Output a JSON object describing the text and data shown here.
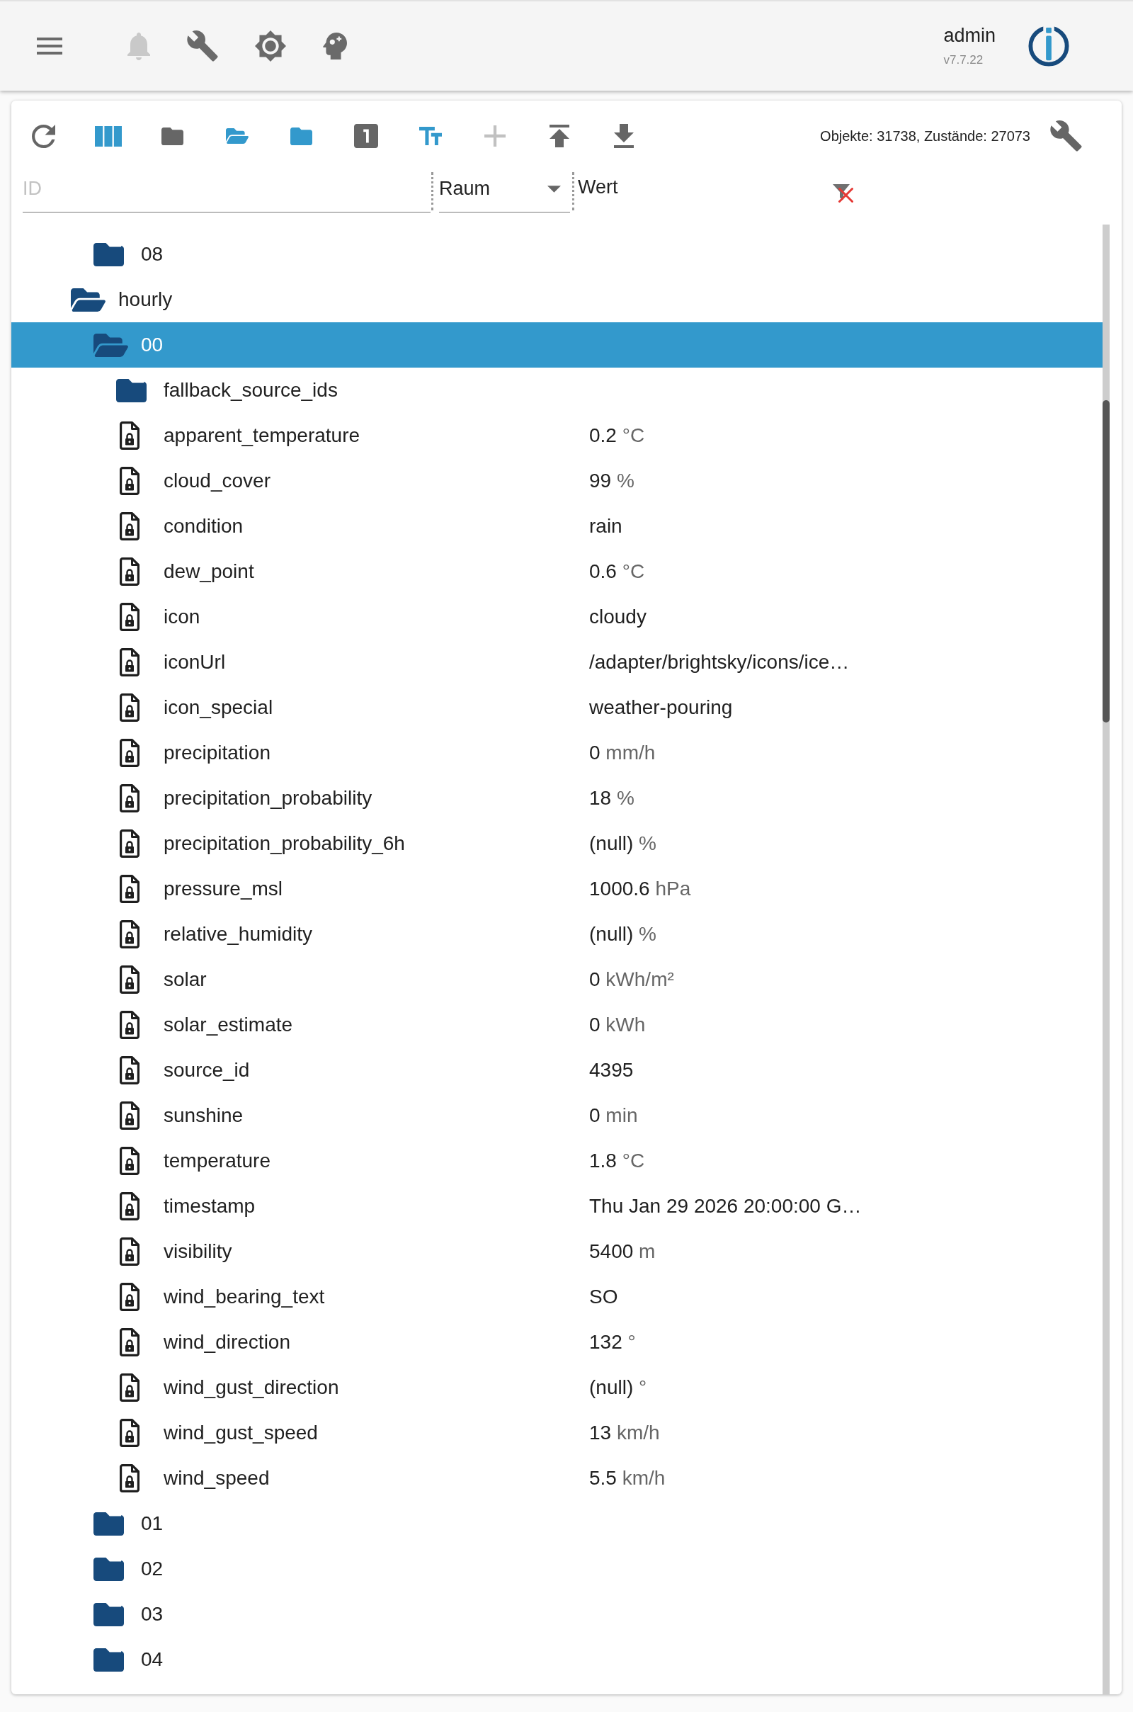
{
  "app_bar": {
    "buttons": [
      {
        "kind": "menu",
        "disabled": false
      },
      {
        "kind": "notifications",
        "disabled": true
      },
      {
        "kind": "wrench",
        "disabled": false
      },
      {
        "kind": "gear",
        "disabled": false
      },
      {
        "kind": "head",
        "disabled": false
      }
    ],
    "user": "admin",
    "version": "v7.7.22"
  },
  "toolbar": {
    "buttons": [
      {
        "kind": "refresh",
        "active": false,
        "disabled": false
      },
      {
        "kind": "columns",
        "active": true,
        "disabled": false
      },
      {
        "kind": "folder",
        "active": false,
        "disabled": false
      },
      {
        "kind": "folder_open",
        "active": true,
        "disabled": false
      },
      {
        "kind": "folder",
        "active": true,
        "disabled": false
      },
      {
        "kind": "number_one",
        "active": false,
        "disabled": false
      },
      {
        "kind": "text_size",
        "active": true,
        "disabled": false
      },
      {
        "kind": "add",
        "active": false,
        "disabled": true
      },
      {
        "kind": "upload",
        "active": false,
        "disabled": false
      },
      {
        "kind": "download",
        "active": false,
        "disabled": false
      }
    ],
    "stats": "Objekte: 31738, Zustände: 27073"
  },
  "filters": {
    "id": {
      "placeholder": "ID"
    },
    "room": {
      "value": "Raum"
    },
    "value_heading": "Wert"
  },
  "tree": [
    {
      "children": [
        {
          "kind": "folder",
          "label": "08",
          "expanded": false,
          "selected": false
        }
      ]
    },
    {
      "kind": "folder",
      "label": "hourly",
      "expanded": true,
      "selected": false,
      "children": [
        {
          "kind": "folder",
          "label": "00",
          "expanded": true,
          "selected": true,
          "children": [
            {
              "kind": "folder",
              "label": "fallback_source_ids",
              "expanded": false,
              "selected": false
            },
            {
              "kind": "state",
              "label": "apparent_temperature",
              "value": "0.2",
              "unit": "°C",
              "selected": false
            },
            {
              "kind": "state",
              "label": "cloud_cover",
              "value": "99",
              "unit": "%",
              "selected": false
            },
            {
              "kind": "state",
              "label": "condition",
              "value": "rain",
              "selected": false
            },
            {
              "kind": "state",
              "label": "dew_point",
              "value": "0.6",
              "unit": "°C",
              "selected": false
            },
            {
              "kind": "state",
              "label": "icon",
              "value": "cloudy",
              "selected": false
            },
            {
              "kind": "state",
              "label": "iconUrl",
              "value": "/adapter/brightsky/icons/ice…",
              "selected": false
            },
            {
              "kind": "state",
              "label": "icon_special",
              "value": "weather-pouring",
              "selected": false
            },
            {
              "kind": "state",
              "label": "precipitation",
              "value": "0",
              "unit": "mm/h",
              "selected": false
            },
            {
              "kind": "state",
              "label": "precipitation_probability",
              "value": "18",
              "unit": "%",
              "selected": false
            },
            {
              "kind": "state",
              "label": "precipitation_probability_6h",
              "value": "(null)",
              "unit": "%",
              "selected": false
            },
            {
              "kind": "state",
              "label": "pressure_msl",
              "value": "1000.6",
              "unit": "hPa",
              "selected": false
            },
            {
              "kind": "state",
              "label": "relative_humidity",
              "value": "(null)",
              "unit": "%",
              "selected": false
            },
            {
              "kind": "state",
              "label": "solar",
              "value": "0",
              "unit": "kWh/m²",
              "selected": false
            },
            {
              "kind": "state",
              "label": "solar_estimate",
              "value": "0",
              "unit": "kWh",
              "selected": false
            },
            {
              "kind": "state",
              "label": "source_id",
              "value": "4395",
              "selected": false
            },
            {
              "kind": "state",
              "label": "sunshine",
              "value": "0",
              "unit": "min",
              "selected": false
            },
            {
              "kind": "state",
              "label": "temperature",
              "value": "1.8",
              "unit": "°C",
              "selected": false
            },
            {
              "kind": "state",
              "label": "timestamp",
              "value": "Thu Jan 29 2026 20:00:00 G…",
              "selected": false
            },
            {
              "kind": "state",
              "label": "visibility",
              "value": "5400",
              "unit": "m",
              "selected": false
            },
            {
              "kind": "state",
              "label": "wind_bearing_text",
              "value": "SO",
              "selected": false
            },
            {
              "kind": "state",
              "label": "wind_direction",
              "value": "132",
              "unit": "°",
              "selected": false
            },
            {
              "kind": "state",
              "label": "wind_gust_direction",
              "value": "(null)",
              "unit": "°",
              "selected": false
            },
            {
              "kind": "state",
              "label": "wind_gust_speed",
              "value": "13",
              "unit": "km/h",
              "selected": false
            },
            {
              "kind": "state",
              "label": "wind_speed",
              "value": "5.5",
              "unit": "km/h",
              "selected": false
            }
          ]
        },
        {
          "kind": "folder",
          "label": "01",
          "expanded": false,
          "selected": false
        },
        {
          "kind": "folder",
          "label": "02",
          "expanded": false,
          "selected": false
        },
        {
          "kind": "folder",
          "label": "03",
          "expanded": false,
          "selected": false
        },
        {
          "kind": "folder",
          "label": "04",
          "expanded": false,
          "selected": false
        }
      ]
    }
  ]
}
